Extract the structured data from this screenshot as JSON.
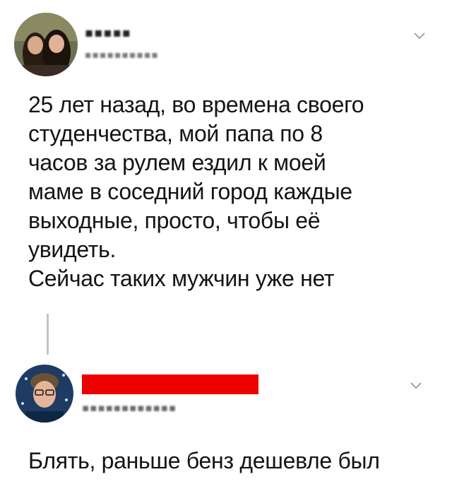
{
  "post": {
    "author_name": "▪▪▪▪▪",
    "author_handle": "▪▪▪▪▪▪▪▪▪▪",
    "text_lines": [
      "25 лет назад, во времена своего",
      "студенчества, мой папа по 8",
      "часов за рулем ездил к моей",
      "маме в соседний город каждые",
      "выходные, просто, чтобы её",
      "увидеть.",
      "Сейчас таких мужчин уже нет"
    ],
    "menu_icon": "chevron-down-icon"
  },
  "reply": {
    "author_handle": "▪▪▪▪▪▪▪▪▪▪▪▪",
    "text": "Блять, раньше бенз дешевле был",
    "redaction_color": "#ee0000",
    "menu_icon": "chevron-down-icon"
  },
  "colors": {
    "text": "#141414",
    "muted": "#9a9a9a",
    "thread_line": "#c4c4c4"
  }
}
